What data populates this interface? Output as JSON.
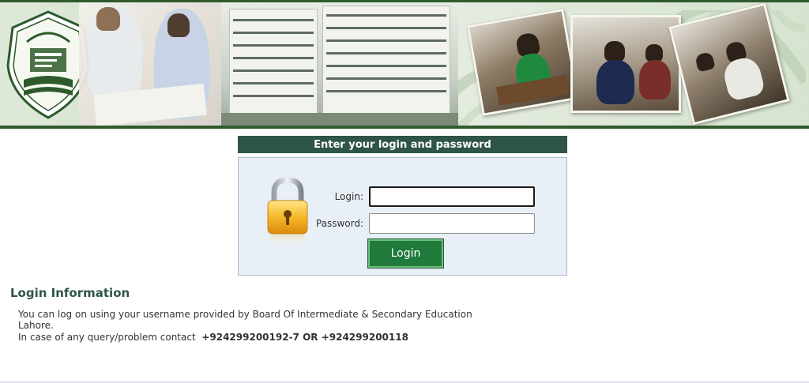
{
  "banner": {
    "emblem_icon": "board-emblem-icon",
    "accent_color": "#2f5a2c"
  },
  "login": {
    "header": "Enter your login and password",
    "login_label": "Login:",
    "password_label": "Password:",
    "login_value": "",
    "password_value": "",
    "button_label": "Login",
    "lock_icon": "padlock-icon",
    "header_color": "#2f5546",
    "button_color": "#1f7a3c"
  },
  "info": {
    "title": "Login Information",
    "line1": "You can log on using your username provided by Board Of Intermediate & Secondary Education",
    "line2": "Lahore.",
    "line3_prefix": "In case of any query/problem contact",
    "line3_phones": "+924299200192-7 OR +924299200118"
  }
}
